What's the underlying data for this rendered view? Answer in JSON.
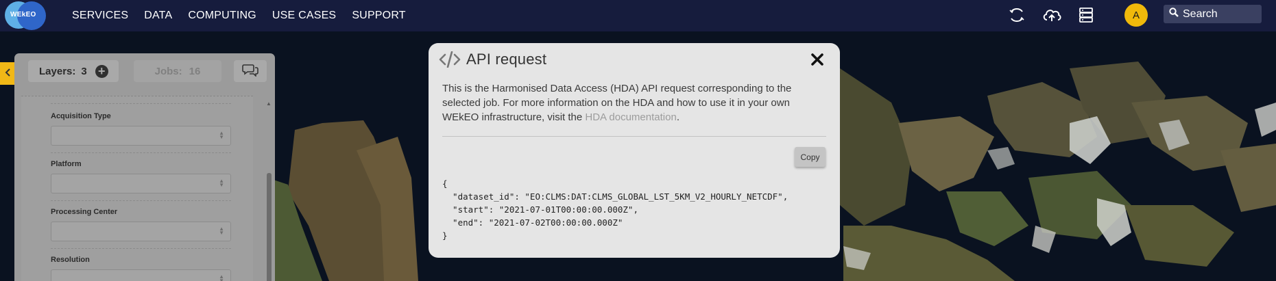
{
  "navbar": {
    "logo_text": "WEkEO",
    "menu": [
      "SERVICES",
      "DATA",
      "COMPUTING",
      "USE CASES",
      "SUPPORT"
    ],
    "icons": [
      "sync-icon",
      "cloud-upload-icon",
      "server-icon"
    ],
    "avatar_initial": "A",
    "search_label": "Search"
  },
  "side_panel": {
    "layers_label": "Layers:",
    "layers_count": "3",
    "jobs_label": "Jobs:",
    "jobs_count": "16",
    "fields": [
      "Acquisition Type",
      "Platform",
      "Processing Center",
      "Resolution"
    ]
  },
  "modal": {
    "title": "API request",
    "description_text": "This is the Harmonised Data Access (HDA) API request corresponding to the selected job. For more information on the HDA and how to use it in your own WEkEO infrastructure, visit the ",
    "link_text": "HDA documentation",
    "description_end": ".",
    "copy_label": "Copy",
    "code_lines": [
      "{",
      "  \"dataset_id\": \"EO:CLMS:DAT:CLMS_GLOBAL_LST_5KM_V2_HOURLY_NETCDF\",",
      "  \"start\": \"2021-07-01T00:00:00.000Z\",",
      "  \"end\": \"2021-07-02T00:00:00.000Z\"",
      "}"
    ]
  },
  "colors": {
    "navbar_bg": "#161c3d",
    "accent_yellow": "#f1b817",
    "modal_bg": "#e5e5e5",
    "panel_bg": "#9b9b9b"
  }
}
